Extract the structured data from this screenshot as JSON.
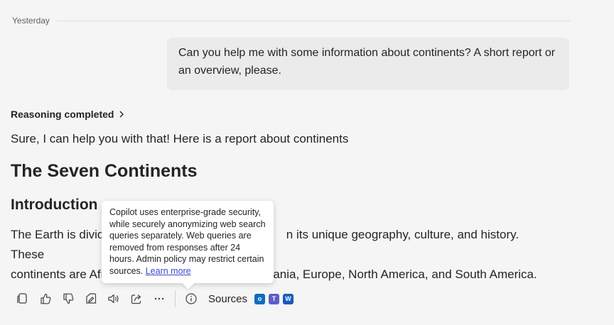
{
  "date_label": "Yesterday",
  "user_message": "Can you help me with some information about continents? A short report or an overview, please.",
  "reasoning_label": "Reasoning completed",
  "response": {
    "intro": "Sure, I can help you with that! Here is a report about continents",
    "heading1": "The Seven Continents",
    "heading2": "Introduction",
    "paragraph_part1": "The Earth is divide",
    "paragraph_part2": "n its unique geography, culture, and history. These",
    "paragraph_part3": "continents are Afr",
    "paragraph_part4": "ania, Europe, North America, and South America."
  },
  "tooltip": {
    "text": "Copilot uses enterprise-grade security, while securely anonymizing web search queries separately. Web queries are removed from responses after 24 hours. Admin policy may restrict certain sources. ",
    "link": "Learn more"
  },
  "toolbar": {
    "buttons": [
      "copy-icon",
      "thumbs-up-icon",
      "thumbs-down-icon",
      "edit-notes-icon",
      "speaker-icon",
      "share-icon",
      "more-icon"
    ],
    "info_icon": "info-icon",
    "sources_label": "Sources",
    "source_apps": [
      {
        "name": "outlook-icon",
        "color": "#0f6cbd"
      },
      {
        "name": "teams-icon",
        "color": "#5b5fc7"
      },
      {
        "name": "word-icon",
        "color": "#185abd"
      }
    ]
  },
  "colors": {
    "background": "#f5f5f5",
    "user_bubble": "#ebebeb",
    "link": "#3b49c9"
  }
}
